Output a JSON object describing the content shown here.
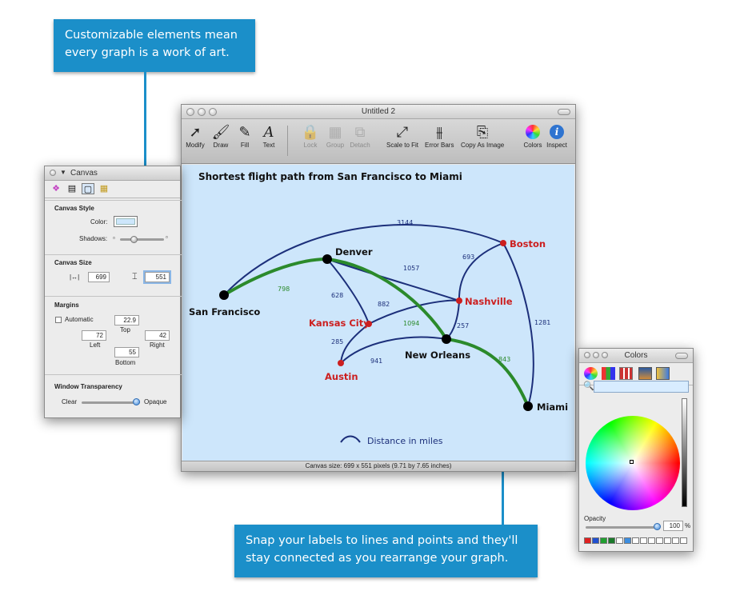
{
  "callouts": {
    "top": "Customizable elements mean every graph is a work of art.",
    "bottom": "Snap your labels to lines and points and they'll stay connected as you rearrange your graph."
  },
  "main_window": {
    "title": "Untitled 2",
    "toolbar": [
      {
        "label": "Modify",
        "icon": "arrow-cursor-icon",
        "enabled": true
      },
      {
        "label": "Draw",
        "icon": "brush-icon",
        "enabled": true
      },
      {
        "label": "Fill",
        "icon": "paint-tube-icon",
        "enabled": true
      },
      {
        "label": "Text",
        "icon": "text-A-icon",
        "enabled": true
      },
      {
        "label": "Lock",
        "icon": "lock-icon",
        "enabled": false
      },
      {
        "label": "Group",
        "icon": "group-icon",
        "enabled": false
      },
      {
        "label": "Detach",
        "icon": "detach-icon",
        "enabled": false
      },
      {
        "label": "Scale to Fit",
        "icon": "scale-to-fit-icon",
        "enabled": true
      },
      {
        "label": "Error Bars",
        "icon": "error-bars-icon",
        "enabled": true
      },
      {
        "label": "Copy As Image",
        "icon": "copy-image-icon",
        "enabled": true
      },
      {
        "label": "Colors",
        "icon": "color-wheel-icon",
        "enabled": true
      },
      {
        "label": "Inspect",
        "icon": "info-icon",
        "enabled": true
      }
    ],
    "status": "Canvas size: 699 x 551 pixels (9.71 by 7.65 inches)"
  },
  "graph": {
    "title": "Shortest flight path from San Francisco to Miami",
    "legend": "Distance in miles",
    "colors": {
      "edge": "#1c2f7a",
      "path": "#2b8a2b",
      "hub": "#000000",
      "alt": "#cc1f1f",
      "bg": "#cde6fb"
    },
    "nodes": {
      "sf": "San Francisco",
      "denver": "Denver",
      "boston": "Boston",
      "nashville": "Nashville",
      "kansas": "Kansas City",
      "austin": "Austin",
      "neworleans": "New Orleans",
      "miami": "Miami"
    },
    "edges": {
      "sf_boston": "3144",
      "sf_denver": "798",
      "denver_nashville": "1057",
      "denver_kansas": "628",
      "kansas_nashville": "882",
      "denver_neworleans": "1094",
      "boston_nashville": "693",
      "boston_miami": "1281",
      "nashville_neworleans": "257",
      "kansas_austin": "285",
      "austin_neworleans": "941",
      "neworleans_miami": "843"
    }
  },
  "canvas_inspector": {
    "title": "Canvas",
    "canvas_style": "Canvas Style",
    "color_label": "Color:",
    "shadows_label": "Shadows:",
    "canvas_size": "Canvas Size",
    "width": "699",
    "height": "551",
    "margins": "Margins",
    "automatic": "Automatic",
    "top": "22.9",
    "top_label": "Top",
    "left": "72",
    "left_label": "Left",
    "right": "42",
    "right_label": "Right",
    "bottom": "55",
    "bottom_label": "Bottom",
    "window_transparency": "Window Transparency",
    "clear": "Clear",
    "opaque": "Opaque",
    "shadows_level": 0.35,
    "transparency_level": 1.0
  },
  "colors_panel": {
    "title": "Colors",
    "opacity_label": "Opacity",
    "opacity_value": "100",
    "opacity_unit": "%",
    "opacity_level": 1.0,
    "swatches": [
      "#e02020",
      "#2050d0",
      "#20a030",
      "#1a7a2a",
      "#ffffff",
      "#3d8ee0",
      "#ffffff",
      "#ffffff",
      "#ffffff",
      "#ffffff",
      "#ffffff",
      "#ffffff",
      "#ffffff"
    ]
  }
}
